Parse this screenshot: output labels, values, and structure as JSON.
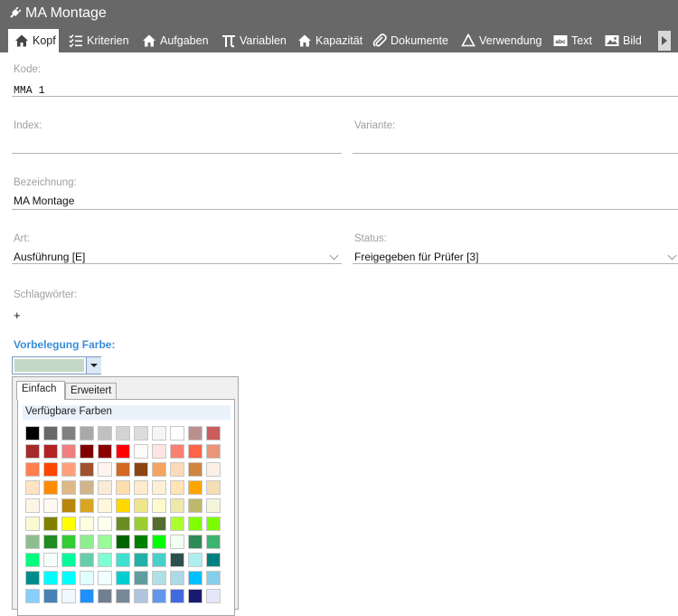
{
  "window": {
    "title": "MA Montage"
  },
  "tabs": [
    {
      "label": "Kopf",
      "icon": "home-icon"
    },
    {
      "label": "Kriterien",
      "icon": "checklist-icon"
    },
    {
      "label": "Aufgaben",
      "icon": "home-icon"
    },
    {
      "label": "Variablen",
      "icon": "pi-icon"
    },
    {
      "label": "Kapazität",
      "icon": "home-icon"
    },
    {
      "label": "Dokumente",
      "icon": "paperclip-icon"
    },
    {
      "label": "Verwendung",
      "icon": "recycle-icon"
    },
    {
      "label": "Text",
      "icon": "abc-text-icon"
    },
    {
      "label": "Bild",
      "icon": "image-icon"
    }
  ],
  "form": {
    "kode": {
      "label": "Kode:",
      "value": "MMA 1"
    },
    "index": {
      "label": "Index:",
      "value": ""
    },
    "variante": {
      "label": "Variante:",
      "value": ""
    },
    "bezeichnung": {
      "label": "Bezeichnung:",
      "value": "MA Montage"
    },
    "art": {
      "label": "Art:",
      "value": "Ausführung [E]"
    },
    "status": {
      "label": "Status:",
      "value": "Freigegeben für Prüfer [3]"
    },
    "schlagwoerter": {
      "label": "Schlagwörter:",
      "add": "+"
    }
  },
  "color_section": {
    "title": "Vorbelegung Farbe:",
    "selected_color": "#c5d8c7",
    "popup": {
      "tabs": [
        "Einfach",
        "Erweitert"
      ],
      "active_tab": "Einfach",
      "heading": "Verfügbare Farben",
      "colors": [
        [
          "#000000",
          "#696969",
          "#808080",
          "#a9a9a9",
          "#c0c0c0",
          "#d3d3d3",
          "#dcdcdc",
          "#f5f5f5",
          "#ffffff",
          "#bc8f8f",
          "#cd5c5c"
        ],
        [
          "#a52a2a",
          "#b22222",
          "#f08080",
          "#800000",
          "#8b0000",
          "#ff0000",
          "#fffafa",
          "#ffe4e1",
          "#fa8072",
          "#ff6347",
          "#e9967a"
        ],
        [
          "#ff7f50",
          "#ff4500",
          "#ffa07a",
          "#a0522d",
          "#fff5ee",
          "#d2691e",
          "#8b4513",
          "#f4a460",
          "#ffdab9",
          "#cd853f",
          "#faf0e6"
        ],
        [
          "#ffe4c4",
          "#ff8c00",
          "#deb887",
          "#d2b48c",
          "#faebd7",
          "#ffdead",
          "#ffebcd",
          "#ffefd5",
          "#ffe4b5",
          "#ffa500",
          "#f5deb3"
        ],
        [
          "#fdf5e6",
          "#fffaf0",
          "#b8860b",
          "#daa520",
          "#fff8dc",
          "#ffd700",
          "#f0e68c",
          "#fffacd",
          "#eee8aa",
          "#bdb76b",
          "#f5f5dc"
        ],
        [
          "#fafad2",
          "#808000",
          "#ffff00",
          "#ffffe0",
          "#fffff0",
          "#6b8e23",
          "#9acd32",
          "#556b2f",
          "#adff2f",
          "#7fff00",
          "#7cfc00"
        ],
        [
          "#8fbc8f",
          "#228b22",
          "#32cd32",
          "#90ee90",
          "#98fb98",
          "#006400",
          "#008000",
          "#00ff00",
          "#f0fff0",
          "#2e8b57",
          "#3cb371"
        ],
        [
          "#00ff7f",
          "#f5fffa",
          "#00fa9a",
          "#66cdaa",
          "#7fffd4",
          "#40e0d0",
          "#20b2aa",
          "#48d1cc",
          "#2f4f4f",
          "#afeeee",
          "#008080"
        ],
        [
          "#008b8b",
          "#00ffff",
          "#00ffff",
          "#e0ffff",
          "#f0ffff",
          "#00ced1",
          "#5f9ea0",
          "#b0e0e6",
          "#add8e6",
          "#00bfff",
          "#87ceeb"
        ],
        [
          "#87cefa",
          "#4682b4",
          "#f0f8ff",
          "#1e90ff",
          "#708090",
          "#778899",
          "#b0c4de",
          "#6495ed",
          "#4169e1",
          "#191970",
          "#e6e6fa"
        ]
      ]
    }
  }
}
